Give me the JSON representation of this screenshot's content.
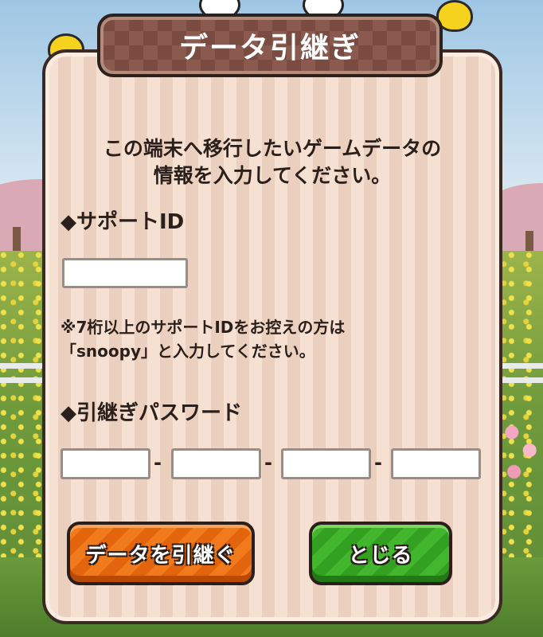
{
  "dialog": {
    "title": "データ引継ぎ",
    "intro_line1": "この端末へ移行したいゲームデータの",
    "intro_line2": "情報を入力してください。",
    "support_id_label": "◆サポートID",
    "support_id_value": "",
    "note_line1": "※7桁以上のサポートIDをお控えの方は",
    "note_line2": "「snoopy」と入力してください。",
    "password_label": "◆引継ぎパスワード",
    "password_values": [
      "",
      "",
      "",
      ""
    ],
    "separator": "-",
    "transfer_button": "データを引継ぐ",
    "close_button": "とじる"
  }
}
